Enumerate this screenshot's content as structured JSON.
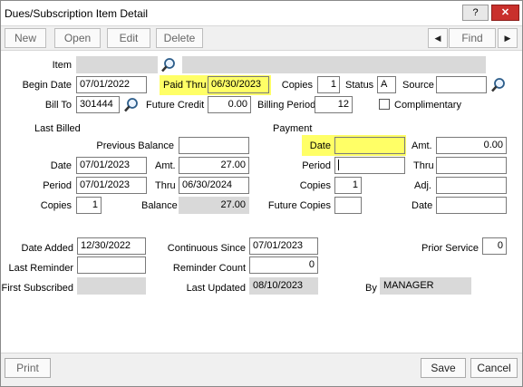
{
  "window": {
    "title": "Dues/Subscription Item Detail",
    "help": "?",
    "close": "✕"
  },
  "toolbar": {
    "new": "New",
    "open": "Open",
    "edit": "Edit",
    "delete": "Delete",
    "prev": "◀",
    "find": "Find",
    "next": "▶"
  },
  "header": {
    "item_label": "Item",
    "begin_date_label": "Begin Date",
    "begin_date": "07/01/2022",
    "paid_thru_label": "Paid Thru",
    "paid_thru": "06/30/2023",
    "copies_label": "Copies",
    "copies": "1",
    "status_label": "Status",
    "status": "A",
    "source_label": "Source",
    "source": "",
    "bill_to_label": "Bill To",
    "bill_to": "301444",
    "future_credit_label": "Future Credit",
    "future_credit": "0.00",
    "billing_period_label": "Billing Period",
    "billing_period": "12",
    "complimentary_label": "Complimentary"
  },
  "last_billed": {
    "section_label": "Last Billed",
    "prev_balance_label": "Previous Balance",
    "prev_balance": "",
    "date_label": "Date",
    "date": "07/01/2023",
    "amt_label": "Amt.",
    "amt": "27.00",
    "period_label": "Period",
    "period": "07/01/2023",
    "thru_label": "Thru",
    "thru": "06/30/2024",
    "copies_label": "Copies",
    "copies": "1",
    "balance_label": "Balance",
    "balance": "27.00"
  },
  "payment": {
    "section_label": "Payment",
    "date_label": "Date",
    "date": "",
    "amt_label": "Amt.",
    "amt": "0.00",
    "period_label": "Period",
    "period": "",
    "thru_label": "Thru",
    "thru": "",
    "copies_label": "Copies",
    "copies": "1",
    "adj_label": "Adj.",
    "adj": "",
    "future_copies_label": "Future Copies",
    "future_copies": "",
    "date2_label": "Date",
    "date2": ""
  },
  "history": {
    "date_added_label": "Date Added",
    "date_added": "12/30/2022",
    "continuous_since_label": "Continuous Since",
    "continuous_since": "07/01/2023",
    "prior_service_label": "Prior Service",
    "prior_service": "0",
    "last_reminder_label": "Last Reminder",
    "last_reminder": "",
    "reminder_count_label": "Reminder Count",
    "reminder_count": "0",
    "first_subscribed_label": "First Subscribed",
    "first_subscribed": "",
    "last_updated_label": "Last Updated",
    "last_updated": "08/10/2023",
    "by_label": "By",
    "by": "MANAGER"
  },
  "footer": {
    "print": "Print",
    "save": "Save",
    "cancel": "Cancel"
  },
  "colors": {
    "highlight": "#ffff66",
    "readonly": "#d9d9d9",
    "close": "#c9302c"
  },
  "icons": {
    "lookup": "magnifier-icon",
    "prev": "chevron-left-icon",
    "next": "chevron-right-icon"
  }
}
